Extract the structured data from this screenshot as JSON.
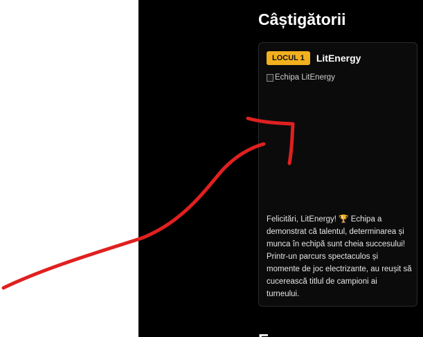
{
  "winners": {
    "title": "Câștigătorii",
    "card": {
      "badge": "LOCUL 1",
      "team_name": "LitEnergy",
      "image_alt": "Echipa LitEnergy",
      "description": "Felicitări, LitEnergy! 🏆 Echipa a demonstrat că talentul, determinarea și munca în echipă sunt cheia succesului! Printr-un parcurs spectaculos și momente de joc electrizante, au reușit să cucerească titlul de campioni ai turneului."
    }
  },
  "next_section": {
    "title_fragment": "E..."
  },
  "colors": {
    "badge_bg": "#f2b01e",
    "page_bg": "#000000",
    "annotation": "#e02020"
  }
}
